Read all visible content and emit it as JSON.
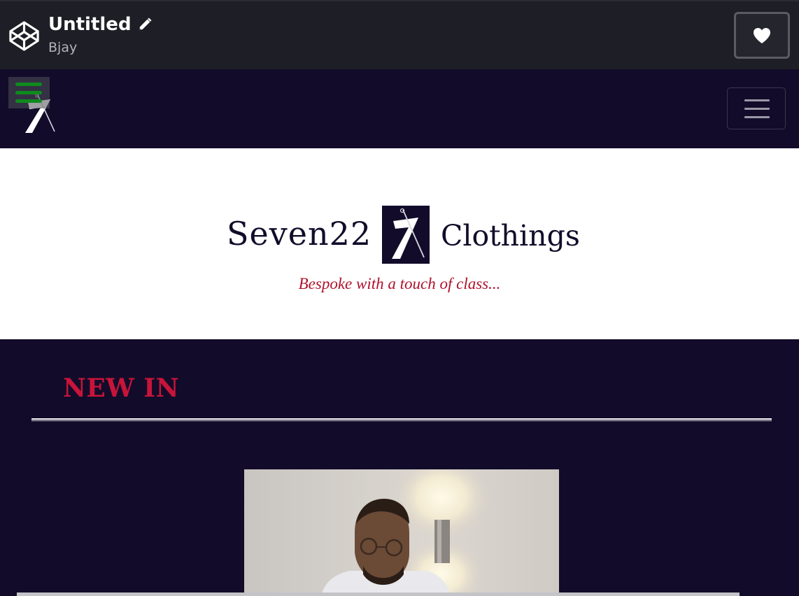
{
  "codepen": {
    "title": "Untitled",
    "author": "Bjay",
    "icons": {
      "logo": "codepen-logo-icon",
      "edit": "pencil-icon",
      "like": "heart-icon"
    }
  },
  "navbar": {
    "icons": {
      "logo": "seven22-logo-icon",
      "overlay_menu": "hamburger-icon",
      "toggler": "hamburger-icon"
    }
  },
  "hero": {
    "brand_left": "Seven22",
    "brand_right": "Clothings",
    "tagline": "Bespoke with a touch of class..."
  },
  "new_in": {
    "heading": "NEW IN"
  },
  "colors": {
    "codepen_bar": "#1e1f26",
    "site_bg": "#120c2a",
    "accent_red": "#c8143a",
    "tagline_red": "#b0122c",
    "menu_green": "#0f8a1e"
  }
}
